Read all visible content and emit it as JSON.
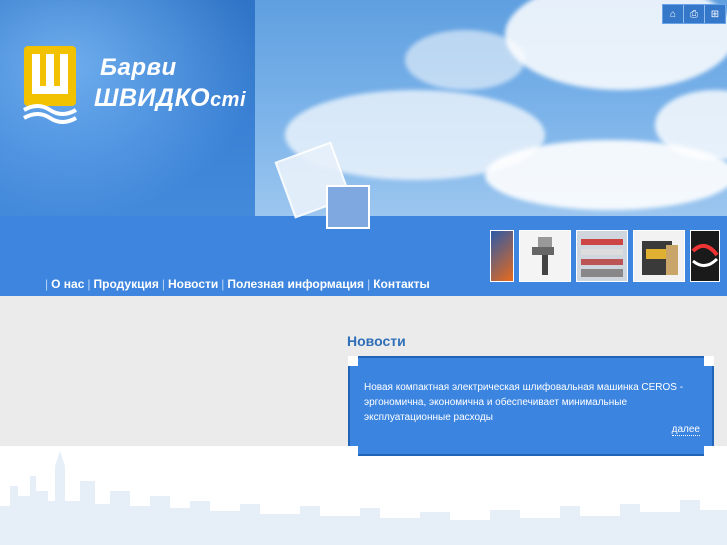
{
  "brand": {
    "line1": "Барви",
    "line2_main": "ШВИДКО",
    "line2_small": "сті"
  },
  "top_icons": [
    "home-icon",
    "print-icon",
    "sitemap-icon"
  ],
  "nav": {
    "items": [
      "О нас",
      "Продукция",
      "Новости",
      "Полезная информация",
      "Контакты"
    ]
  },
  "news": {
    "title": "Новости",
    "text": "Новая компактная электрическая шлифовальная машинка CEROS - эргономична, экономична и обеспечивает минимальные эксплуатационные расходы",
    "more": "далее"
  },
  "colors": {
    "accent_blue": "#3d85de",
    "title_blue": "#2e6fb8",
    "logo_yellow": "#f2c200"
  }
}
